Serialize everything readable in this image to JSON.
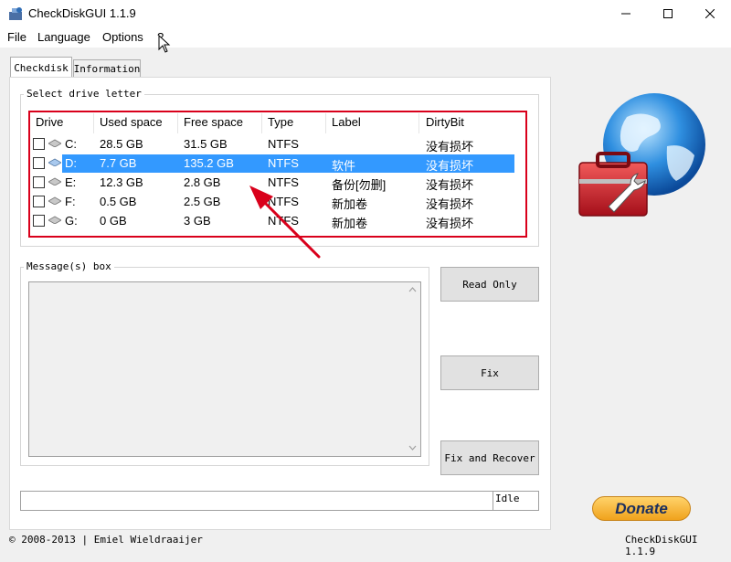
{
  "window": {
    "title": "CheckDiskGUI 1.1.9",
    "minimize_icon": "minimize-icon",
    "maximize_icon": "maximize-icon",
    "close_icon": "close-icon"
  },
  "menu": [
    "File",
    "Language",
    "Options",
    "?"
  ],
  "tabs": [
    {
      "label": "Checkdisk",
      "active": true
    },
    {
      "label": "Information",
      "active": false
    }
  ],
  "drive_group": {
    "label": "Select drive letter",
    "columns": [
      "Drive",
      "Used space",
      "Free space",
      "Type",
      "Label",
      "DirtyBit"
    ],
    "rows": [
      {
        "drive": "C:",
        "used": "28.5 GB",
        "free": "31.5 GB",
        "type": "NTFS",
        "label": "",
        "dirty": "没有损坏",
        "selected": false
      },
      {
        "drive": "D:",
        "used": "7.7 GB",
        "free": "135.2 GB",
        "type": "NTFS",
        "label": "软件",
        "dirty": "没有损坏",
        "selected": true
      },
      {
        "drive": "E:",
        "used": "12.3 GB",
        "free": "2.8 GB",
        "type": "NTFS",
        "label": "备份[勿删]",
        "dirty": "没有损坏",
        "selected": false
      },
      {
        "drive": "F:",
        "used": "0.5 GB",
        "free": "2.5 GB",
        "type": "NTFS",
        "label": "新加卷",
        "dirty": "没有损坏",
        "selected": false
      },
      {
        "drive": "G:",
        "used": "0 GB",
        "free": "3 GB",
        "type": "NTFS",
        "label": "新加卷",
        "dirty": "没有损坏",
        "selected": false
      }
    ]
  },
  "message_group": {
    "label": "Message(s) box"
  },
  "buttons": {
    "read_only": "Read Only",
    "fix": "Fix",
    "fix_recover": "Fix and Recover"
  },
  "status": {
    "state": "Idle"
  },
  "donate": {
    "label": "Donate"
  },
  "footer": {
    "copyright": "© 2008-2013 | Emiel Wieldraaijer",
    "version": "CheckDiskGUI 1.1.9"
  },
  "colors": {
    "selection": "#3399ff",
    "highlight_border": "#d9001b",
    "arrow": "#d9001b",
    "donate": "#f5a623"
  },
  "icons": [
    "app-icon",
    "drive-icon",
    "globe-toolbox-icon",
    "cursor-icon",
    "scroll-up-icon",
    "scroll-down-icon"
  ]
}
